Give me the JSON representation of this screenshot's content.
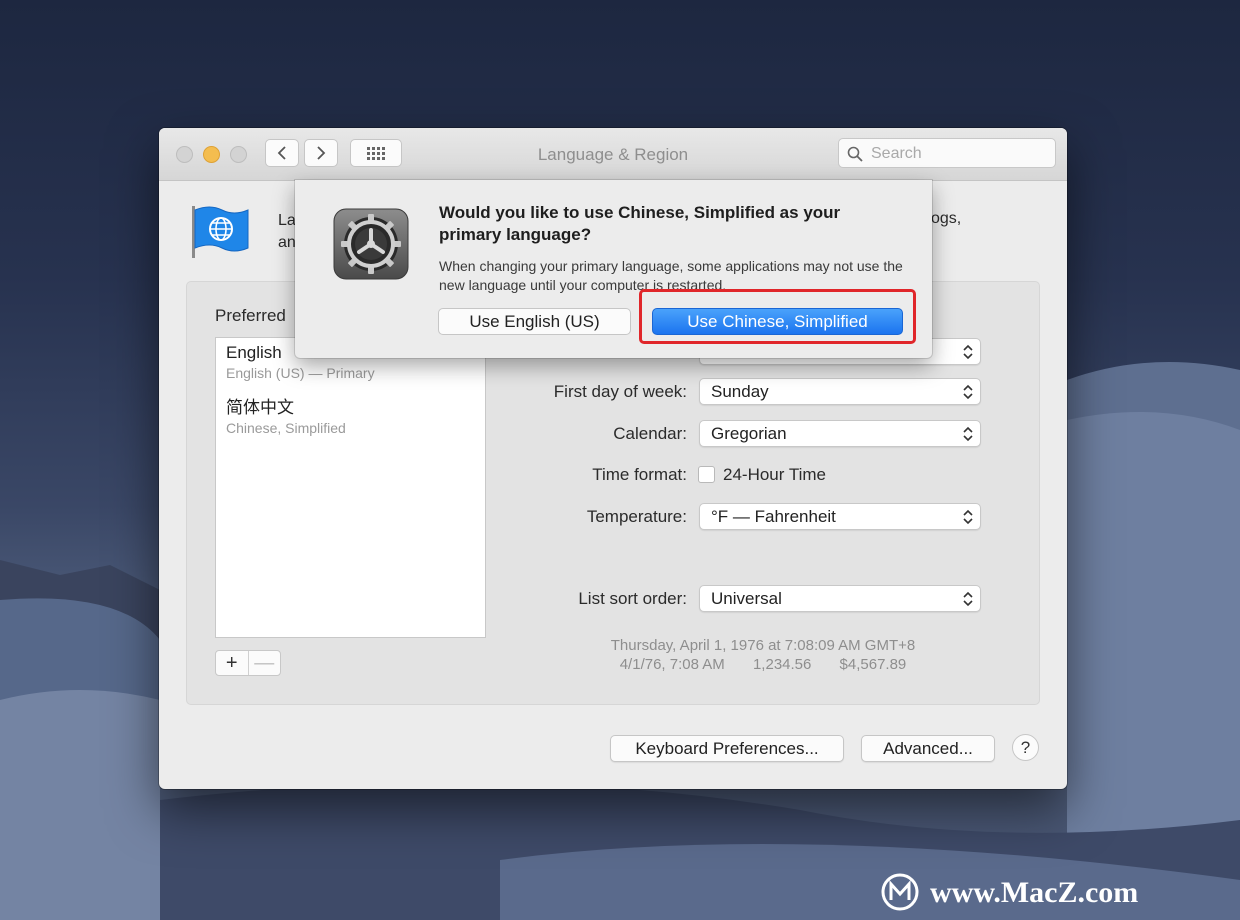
{
  "window": {
    "title": "Language & Region",
    "search_placeholder": "Search"
  },
  "header": {
    "text_left": "La",
    "text_left_line2": "an",
    "text_right": "ogs,"
  },
  "languages": {
    "label": "Preferred",
    "items": [
      {
        "name": "English",
        "sub": "English (US) — Primary"
      },
      {
        "name": "简体中文",
        "sub": "Chinese, Simplified"
      }
    ],
    "add": "+",
    "remove": "—"
  },
  "settings": {
    "first_day": {
      "label": "First day of week:",
      "value": "Sunday"
    },
    "calendar": {
      "label": "Calendar:",
      "value": "Gregorian"
    },
    "time_format": {
      "label": "Time format:",
      "checkbox": "24-Hour Time",
      "checked": false
    },
    "temperature": {
      "label": "Temperature:",
      "value": "°F — Fahrenheit"
    },
    "sort_order": {
      "label": "List sort order:",
      "value": "Universal"
    }
  },
  "sample": {
    "line1": "Thursday, April 1, 1976 at 7:08:09 AM GMT+8",
    "date_short": "4/1/76, 7:08 AM",
    "number": "1,234.56",
    "currency": "$4,567.89"
  },
  "footer": {
    "keyboard": "Keyboard Preferences...",
    "advanced": "Advanced...",
    "help": "?"
  },
  "dialog": {
    "title": "Would you like to use Chinese, Simplified as your primary language?",
    "message": "When changing your primary language, some applications may not use the new language until your computer is restarted.",
    "btn_secondary": "Use English (US)",
    "btn_primary": "Use Chinese, Simplified"
  },
  "watermark": {
    "text": "www.MacZ.com"
  },
  "colors": {
    "accent": "#1b74ef",
    "highlight": "#e0262a",
    "minimize": "#f4bd4f"
  }
}
